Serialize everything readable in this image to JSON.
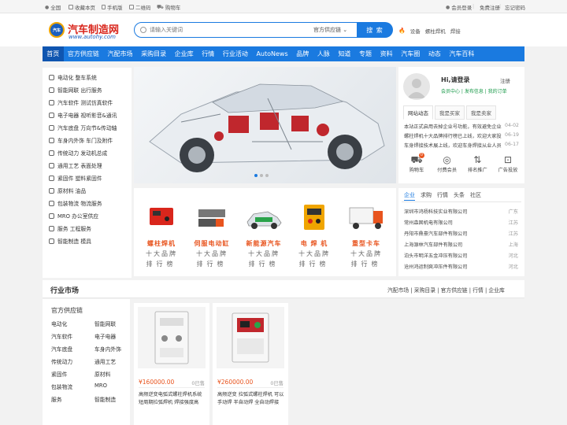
{
  "topbar": {
    "links": [
      "全国",
      "收藏本页",
      "手机版",
      "二维码",
      "购物车"
    ],
    "right_links": [
      "会员登录",
      "免费注册",
      "忘记密码"
    ]
  },
  "header": {
    "logo_badge": "汽车",
    "logo_title": "汽车制造网",
    "logo_url": "www.autohy.com",
    "search_placeholder": "请输入关键词",
    "search_category": "官方供应链",
    "search_button": "搜 索",
    "hot_keywords": [
      "设备",
      "螺柱焊机",
      "焊接"
    ]
  },
  "nav": {
    "items": [
      "首页",
      "官方供应链",
      "汽配市场",
      "采购目录",
      "企业库",
      "行情",
      "行业活动",
      "AutoNews",
      "品牌",
      "人脉",
      "知道",
      "专题",
      "资料",
      "汽车圈",
      "动态",
      "汽车百科"
    ],
    "active_index": 0
  },
  "categories": [
    "电动化 整车系统",
    "智能网联 出行服务",
    "汽车软件 测试仿真软件",
    "电子电器 视听影音&通讯",
    "汽车底盘 万向节&传动轴",
    "车身内外饰 车门及附件",
    "传统动力 发动机总成",
    "通用工艺 表面处理",
    "紧固件 塑料紧固件",
    "原材料 油品",
    "包装物流 物流服务",
    "MRO 办公室供应",
    "服务 工程服务",
    "智能制造 模具"
  ],
  "banner": {
    "slide_count": 3,
    "active_slide": 1
  },
  "rankings": [
    {
      "name": "螺柱焊机",
      "line2": "十大品牌",
      "line3": "排行榜"
    },
    {
      "name": "伺服电动缸",
      "line2": "十大品牌",
      "line3": "排行榜"
    },
    {
      "name": "新能源汽车",
      "line2": "十大品牌",
      "line3": "排行榜"
    },
    {
      "name": "电 焊 机",
      "line2": "十大品牌",
      "line3": "排行榜"
    },
    {
      "name": "重型卡车",
      "line2": "十大品牌",
      "line3": "排行榜"
    }
  ],
  "user": {
    "greeting": "Hi,请登录",
    "register": "注册",
    "member_links": "会员中心 | 发布信息 | 我的订单",
    "tabs": [
      "网站动态",
      "我是买家",
      "我是卖家"
    ],
    "news": [
      {
        "text": "本站正式启用去掉企业号功能，有效避免企业",
        "date": "04-02"
      },
      {
        "text": "螺柱焊机十大品牌排行榜已上线，欢迎大家投",
        "date": "06-19"
      },
      {
        "text": "车身焊接技术展上线，欢迎车身焊接从业人员",
        "date": "06-17"
      }
    ],
    "icons": [
      {
        "label": "购物车",
        "icon": "cart-icon",
        "badge": "0"
      },
      {
        "label": "付费会员",
        "icon": "vip-icon"
      },
      {
        "label": "排名推广",
        "icon": "rank-icon"
      },
      {
        "label": "广告投放",
        "icon": "ad-icon"
      }
    ]
  },
  "companies": {
    "tabs": [
      "企业",
      "求购",
      "行情",
      "头条",
      "社区"
    ],
    "rows": [
      {
        "name": "深圳市鸿杨科技实业有限公司",
        "loc": "广东"
      },
      {
        "name": "常州森固机电有限公司",
        "loc": "江苏"
      },
      {
        "name": "丹阳市鼎豪汽车部件有限公司",
        "loc": "江苏"
      },
      {
        "name": "上海源林汽车部件有限公司",
        "loc": "上海"
      },
      {
        "name": "泊头市明洋五金冲压有限公司",
        "loc": "河北"
      },
      {
        "name": "沧州鸿运制爽冲压件有限公司",
        "loc": "河北"
      }
    ]
  },
  "market": {
    "title": "行业市场",
    "links": "汽配市场 | 采购目录 | 官方供应链 | 行情 | 企业库",
    "supply_title": "官方供应链",
    "supply_links": [
      "电动化",
      "智能网联",
      "汽车软件",
      "电子电器",
      "汽车底盘",
      "车身内外饰",
      "传统动力",
      "通用工艺",
      "紧固件",
      "原材料",
      "包装物流",
      "MRO",
      "服务",
      "智能制造"
    ],
    "products": [
      {
        "price": "¥160000.00",
        "sold": "0已售",
        "name": "高频逆变电弧式螺柱焊机系统 短周期拉弧焊机 焊接强度高"
      },
      {
        "price": "¥260000.00",
        "sold": "0已售",
        "name": "高频逆变 拉弧式螺柱焊机 可以手动焊 半自动焊 全自动焊接"
      }
    ]
  },
  "colors": {
    "brand_blue": "#1a7ae0",
    "accent_orange": "#e8541e",
    "logo_red": "#d9261c"
  }
}
